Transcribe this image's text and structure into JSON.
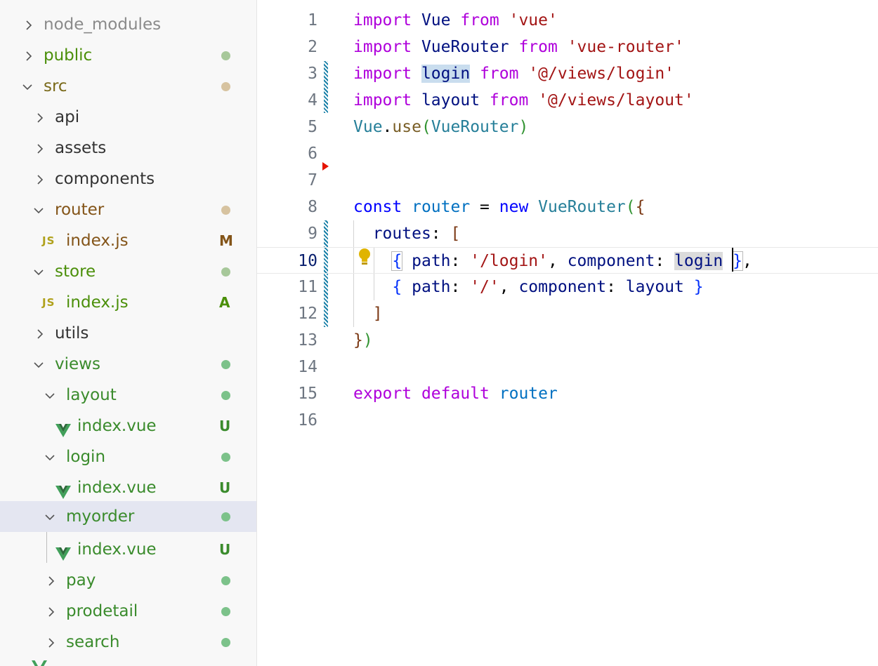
{
  "explorer": {
    "items": [
      {
        "label": "node_modules",
        "status": ""
      },
      {
        "label": "public",
        "status": ""
      },
      {
        "label": "src",
        "status": ""
      },
      {
        "label": "api",
        "status": ""
      },
      {
        "label": "assets",
        "status": ""
      },
      {
        "label": "components",
        "status": ""
      },
      {
        "label": "router",
        "status": ""
      },
      {
        "label": "index.js",
        "status": "M"
      },
      {
        "label": "store",
        "status": ""
      },
      {
        "label": "index.js",
        "status": "A"
      },
      {
        "label": "utils",
        "status": ""
      },
      {
        "label": "views",
        "status": ""
      },
      {
        "label": "layout",
        "status": ""
      },
      {
        "label": "index.vue",
        "status": "U"
      },
      {
        "label": "login",
        "status": ""
      },
      {
        "label": "index.vue",
        "status": "U"
      },
      {
        "label": "myorder",
        "status": ""
      },
      {
        "label": "index.vue",
        "status": "U"
      },
      {
        "label": "pay",
        "status": ""
      },
      {
        "label": "prodetail",
        "status": ""
      },
      {
        "label": "search",
        "status": ""
      }
    ],
    "js_icon_text": "JS"
  },
  "editor": {
    "current_line": 10,
    "line_numbers": [
      "1",
      "2",
      "3",
      "4",
      "5",
      "6",
      "7",
      "8",
      "9",
      "10",
      "11",
      "12",
      "13",
      "14",
      "15",
      "16"
    ],
    "lines": [
      [
        [
          "kw",
          "import"
        ],
        [
          "pn",
          " "
        ],
        [
          "id",
          "Vue"
        ],
        [
          "pn",
          " "
        ],
        [
          "kw",
          "from"
        ],
        [
          "pn",
          " "
        ],
        [
          "str",
          "'vue'"
        ]
      ],
      [
        [
          "kw",
          "import"
        ],
        [
          "pn",
          " "
        ],
        [
          "id",
          "VueRouter"
        ],
        [
          "pn",
          " "
        ],
        [
          "kw",
          "from"
        ],
        [
          "pn",
          " "
        ],
        [
          "str",
          "'vue-router'"
        ]
      ],
      [
        [
          "kw",
          "import"
        ],
        [
          "pn",
          " "
        ],
        [
          "id hl-word",
          "login"
        ],
        [
          "pn",
          " "
        ],
        [
          "kw",
          "from"
        ],
        [
          "pn",
          " "
        ],
        [
          "str",
          "'@/views/login'"
        ]
      ],
      [
        [
          "kw",
          "import"
        ],
        [
          "pn",
          " "
        ],
        [
          "id",
          "layout"
        ],
        [
          "pn",
          " "
        ],
        [
          "kw",
          "from"
        ],
        [
          "pn",
          " "
        ],
        [
          "str",
          "'@/views/layout'"
        ]
      ],
      [
        [
          "ty",
          "Vue"
        ],
        [
          "pn",
          "."
        ],
        [
          "fn",
          "use"
        ],
        [
          "p1",
          "("
        ],
        [
          "ty",
          "VueRouter"
        ],
        [
          "p1",
          ")"
        ]
      ],
      [],
      [],
      [
        [
          "kb",
          "const"
        ],
        [
          "pn",
          " "
        ],
        [
          "var",
          "router"
        ],
        [
          "pn",
          " = "
        ],
        [
          "kb",
          "new"
        ],
        [
          "pn",
          " "
        ],
        [
          "ty",
          "VueRouter"
        ],
        [
          "p1",
          "("
        ],
        [
          "p2",
          "{"
        ]
      ],
      [
        [
          "pn",
          "  "
        ],
        [
          "id",
          "routes"
        ],
        [
          "pn",
          ": "
        ],
        [
          "p2",
          "["
        ]
      ],
      [
        [
          "pn",
          "  "
        ],
        [
          "pn",
          "  "
        ],
        [
          "p3 hl-brk",
          "{"
        ],
        [
          "pn",
          " "
        ],
        [
          "id",
          "path"
        ],
        [
          "pn",
          ": "
        ],
        [
          "str",
          "'/login'"
        ],
        [
          "pn",
          ", "
        ],
        [
          "id",
          "component"
        ],
        [
          "pn",
          ": "
        ],
        [
          "id hl-sel",
          "login"
        ],
        [
          "pn",
          " "
        ],
        [
          "p3 hl-brk",
          "}"
        ],
        [
          "pn",
          ","
        ]
      ],
      [
        [
          "pn",
          "    "
        ],
        [
          "p3",
          "{"
        ],
        [
          "pn",
          " "
        ],
        [
          "id",
          "path"
        ],
        [
          "pn",
          ": "
        ],
        [
          "str",
          "'/'"
        ],
        [
          "pn",
          ", "
        ],
        [
          "id",
          "component"
        ],
        [
          "pn",
          ": "
        ],
        [
          "id",
          "layout"
        ],
        [
          "pn",
          " "
        ],
        [
          "p3",
          "}"
        ]
      ],
      [
        [
          "pn",
          "  "
        ],
        [
          "p2",
          "]"
        ]
      ],
      [
        [
          "p2",
          "}"
        ],
        [
          "p1",
          ")"
        ]
      ],
      [],
      [
        [
          "kw",
          "export"
        ],
        [
          "pn",
          " "
        ],
        [
          "kw",
          "default"
        ],
        [
          "pn",
          " "
        ],
        [
          "var",
          "router"
        ]
      ],
      []
    ]
  },
  "colors": {
    "keyword_control": "#af00db",
    "keyword": "#0000ff",
    "identifier": "#001080",
    "string": "#a31515",
    "type": "#267f99",
    "git_modified_gutter": "#1b81a8",
    "selection_row": "#e4e6f1"
  },
  "icons": {
    "folder_collapsed": "chevron-right-icon",
    "folder_expanded": "chevron-down-icon",
    "vue_file": "vue-icon",
    "js_file": "js-icon",
    "quick_fix": "lightbulb-icon"
  }
}
